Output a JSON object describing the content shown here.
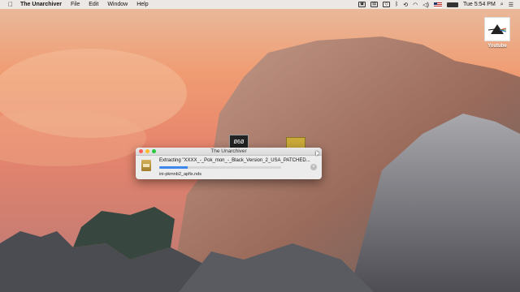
{
  "menubar": {
    "app_name": "The Unarchiver",
    "menus": [
      "File",
      "Edit",
      "Window",
      "Help"
    ],
    "clock": "Tue 5:54 PM"
  },
  "desktop": {
    "icon_label": "Youtube"
  },
  "drag_preview": {
    "label": "Ø6Ø"
  },
  "dialog": {
    "title": "The Unarchiver",
    "status": "Extracting \"XXXX_-_Pok_mon_-_Black_Version_2_USA_PATCHED...",
    "file": "ini-pkmnb2_apfix.nds",
    "progress": 0.23,
    "stop_label": "×"
  },
  "colors": {
    "progress": "#3d86f0",
    "close": "#fc5f57",
    "minimize": "#fdbc2e",
    "maximize": "#28c840"
  }
}
